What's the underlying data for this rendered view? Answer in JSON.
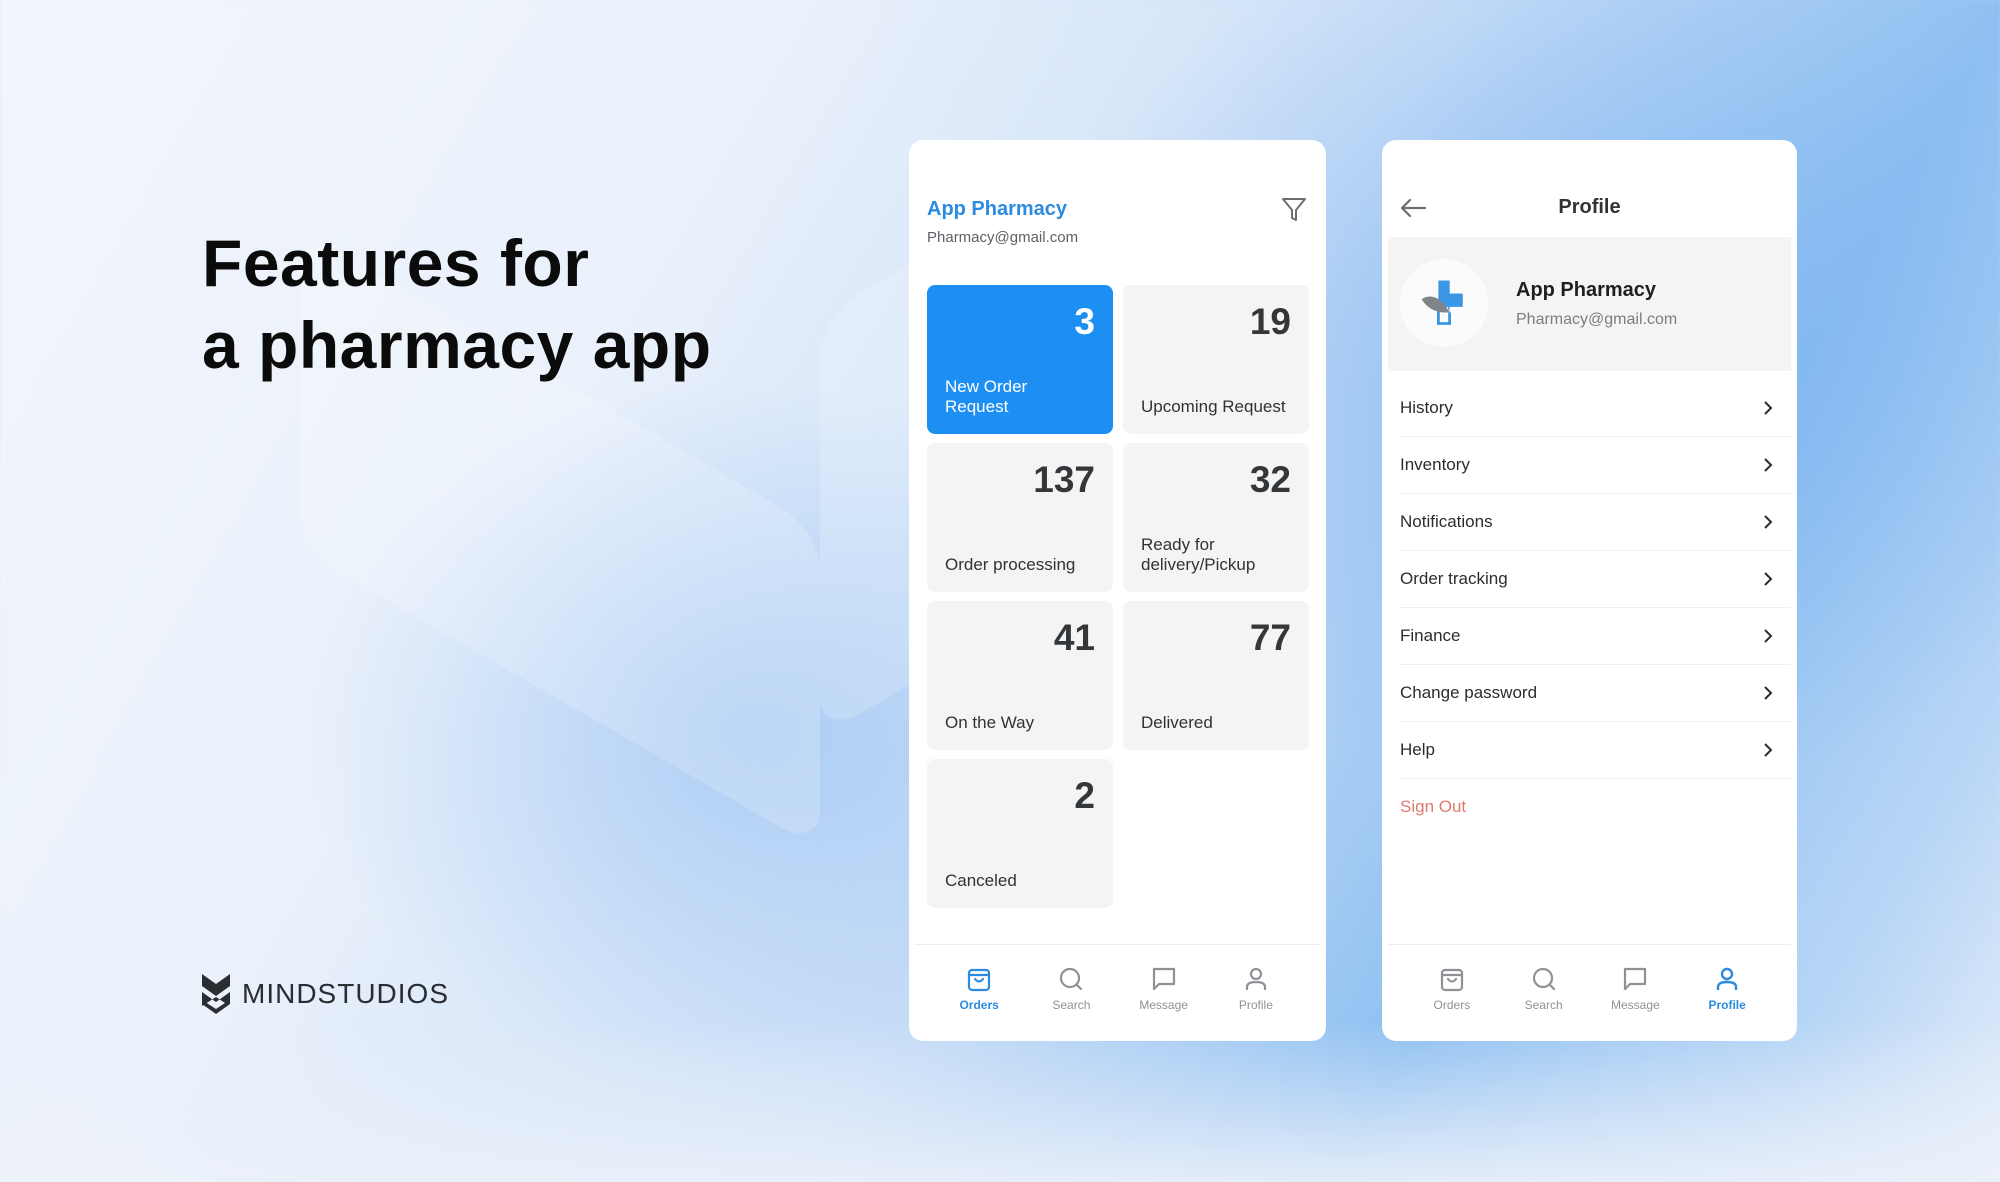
{
  "headline": {
    "line1": "Features for",
    "line2": "a pharmacy app"
  },
  "brand": {
    "logo_text": "MINDSTUDIOS"
  },
  "colors": {
    "accent": "#1e8ff2",
    "accent_text": "#2b8be0",
    "danger": "#e07a70",
    "card_bg": "#f4f4f5"
  },
  "orders_screen": {
    "title": "App Pharmacy",
    "email": "Pharmacy@gmail.com",
    "filter_icon": "filter-funnel-icon",
    "cards": [
      {
        "count": "3",
        "label": "New Order Request",
        "active": true
      },
      {
        "count": "19",
        "label": "Upcoming Request",
        "active": false
      },
      {
        "count": "137",
        "label": "Order processing",
        "active": false
      },
      {
        "count": "32",
        "label": "Ready for delivery/Pickup",
        "active": false
      },
      {
        "count": "41",
        "label": "On the Way",
        "active": false
      },
      {
        "count": "77",
        "label": "Delivered",
        "active": false
      },
      {
        "count": "2",
        "label": "Canceled",
        "active": false
      }
    ],
    "nav": {
      "items": [
        {
          "label": "Orders",
          "icon": "shopping-bag-icon"
        },
        {
          "label": "Search",
          "icon": "search-icon"
        },
        {
          "label": "Message",
          "icon": "message-icon"
        },
        {
          "label": "Profile",
          "icon": "user-icon"
        }
      ],
      "active": "Orders"
    }
  },
  "profile_screen": {
    "title": "Profile",
    "back_icon": "arrow-left-icon",
    "profile": {
      "name": "App Pharmacy",
      "email": "Pharmacy@gmail.com",
      "avatar_icon": "pharmacy-cross-leaf-logo"
    },
    "menu": [
      {
        "label": "History"
      },
      {
        "label": "Inventory"
      },
      {
        "label": "Notifications"
      },
      {
        "label": "Order tracking"
      },
      {
        "label": "Finance"
      },
      {
        "label": "Change password"
      },
      {
        "label": "Help"
      }
    ],
    "sign_out": "Sign Out",
    "nav": {
      "items": [
        {
          "label": "Orders",
          "icon": "shopping-bag-icon"
        },
        {
          "label": "Search",
          "icon": "search-icon"
        },
        {
          "label": "Message",
          "icon": "message-icon"
        },
        {
          "label": "Profile",
          "icon": "user-icon"
        }
      ],
      "active": "Profile"
    }
  }
}
